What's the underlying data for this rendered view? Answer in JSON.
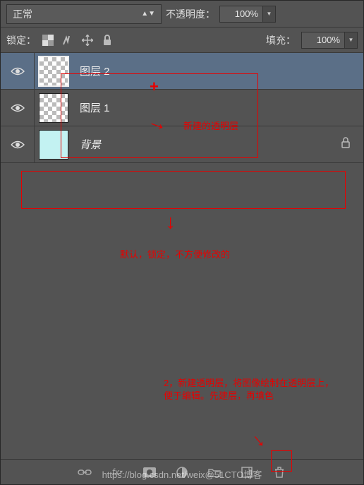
{
  "row1": {
    "blend_mode": "正常",
    "opacity_label": "不透明度：",
    "opacity_value": "100%"
  },
  "row2": {
    "lock_label": "锁定：",
    "fill_label": "填充：",
    "fill_value": "100%"
  },
  "layers": [
    {
      "name": "图层 2",
      "selected": true,
      "thumb": "checker",
      "locked": false
    },
    {
      "name": "图层 1",
      "selected": false,
      "thumb": "checker",
      "locked": false
    },
    {
      "name": "背景",
      "selected": false,
      "thumb": "solid",
      "locked": true,
      "italic": true
    }
  ],
  "annotations": {
    "a1": "新建的透明层",
    "a2": "默认，锁定，不方便修改的",
    "a3": "2，新建透明层，将图像绘制在透明层上，便于编辑。先建层，再填色"
  },
  "watermark": "https://blog.csdn.net/weix@51CTO博客"
}
